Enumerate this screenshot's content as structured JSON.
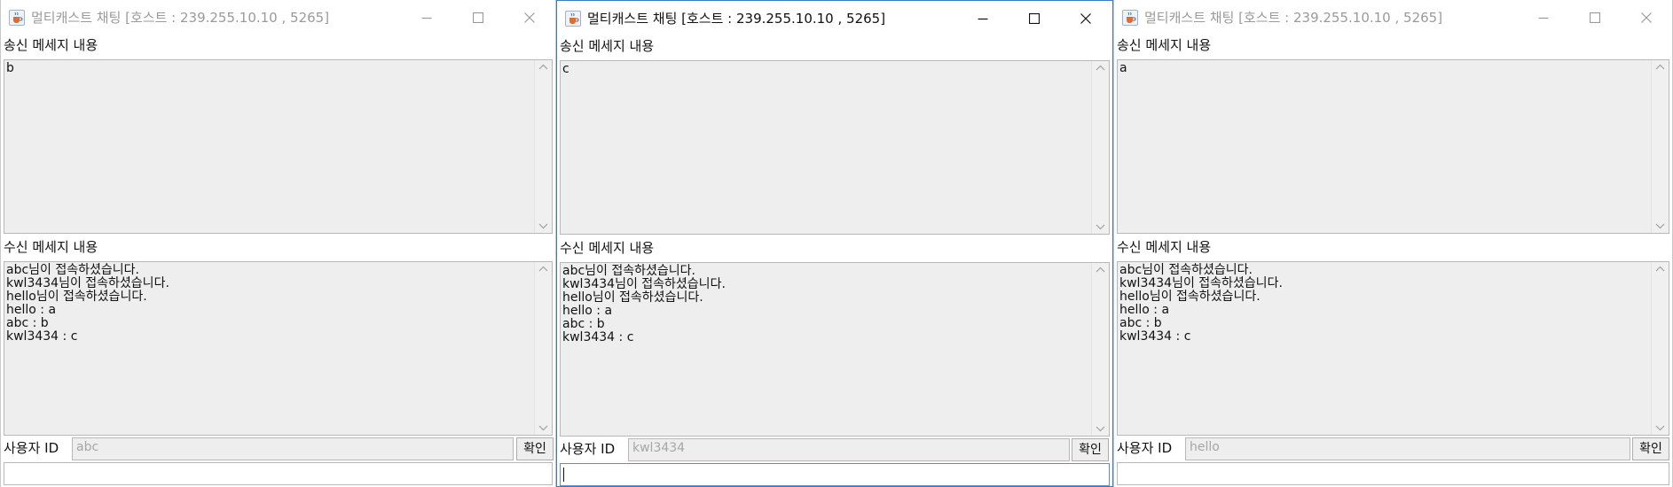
{
  "windows": [
    {
      "title": "멀티캐스트 채팅 [호스트 : 239.255.10.10 , 5265]",
      "active": false,
      "send_label": "송신 메세지 내용",
      "send_text": "b",
      "recv_label": "수신 메세지 내용",
      "recv_text": "abc님이 접속하셨습니다.\nkwl3434님이 접속하셨습니다.\nhello님이 접속하셨습니다.\nhello : a\nabc : b\nkwl3434 : c",
      "uid_label": "사용자 ID",
      "uid_value": "abc",
      "confirm_label": "확인",
      "message_input": ""
    },
    {
      "title": "멀티캐스트 채팅 [호스트 : 239.255.10.10 , 5265]",
      "active": true,
      "send_label": "송신 메세지 내용",
      "send_text": "c",
      "recv_label": "수신 메세지 내용",
      "recv_text": "abc님이 접속하셨습니다.\nkwl3434님이 접속하셨습니다.\nhello님이 접속하셨습니다.\nhello : a\nabc : b\nkwl3434 : c",
      "uid_label": "사용자 ID",
      "uid_value": "kwl3434",
      "confirm_label": "확인",
      "message_input": ""
    },
    {
      "title": "멀티캐스트 채팅 [호스트 : 239.255.10.10 , 5265]",
      "active": false,
      "send_label": "송신 메세지 내용",
      "send_text": "a",
      "recv_label": "수신 메세지 내용",
      "recv_text": "abc님이 접속하셨습니다.\nkwl3434님이 접속하셨습니다.\nhello님이 접속하셨습니다.\nhello : a\nabc : b\nkwl3434 : c",
      "uid_label": "사용자 ID",
      "uid_value": "hello",
      "confirm_label": "확인",
      "message_input": ""
    }
  ],
  "icons": {
    "app": "java-cup-icon",
    "minimize": "minimize-icon",
    "maximize": "maximize-icon",
    "close": "close-icon",
    "scroll_up": "scroll-up-arrow-icon",
    "scroll_down": "scroll-down-arrow-icon"
  },
  "colors": {
    "active_border": "#3a7cc4",
    "area_bg": "#eeeeee",
    "inactive_title": "#9a9a9a"
  }
}
